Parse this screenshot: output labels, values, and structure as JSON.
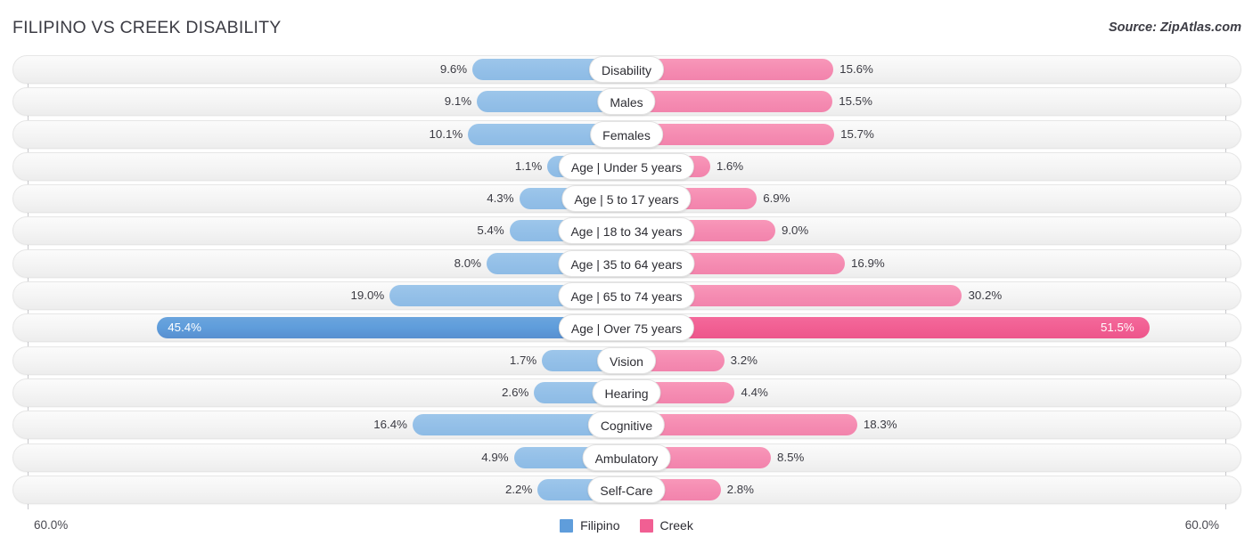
{
  "header": {
    "title": "FILIPINO VS CREEK DISABILITY",
    "source": "Source: ZipAtlas.com"
  },
  "axis": {
    "left_label": "60.0%",
    "right_label": "60.0%",
    "max": 60.0
  },
  "legend": [
    {
      "name": "legend-filipino",
      "label": "Filipino",
      "color": "#5f9ddb"
    },
    {
      "name": "legend-creek",
      "label": "Creek",
      "color": "#f15f93"
    }
  ],
  "colors": {
    "filipino": "#94c0e8",
    "creek": "#f58cb2",
    "filipino_highlight": "#5f9ddb",
    "creek_highlight": "#f15f93",
    "track": "#f4f4f4",
    "text": "#3a3a42"
  },
  "chart_data": {
    "type": "bar",
    "title": "FILIPINO VS CREEK DISABILITY",
    "subtitle": "Source: ZipAtlas.com",
    "orientation": "horizontal-diverging",
    "xlabel": "",
    "ylabel": "",
    "xlim": [
      60.0,
      60.0
    ],
    "grid": false,
    "legend_position": "bottom-center",
    "categories": [
      "Disability",
      "Males",
      "Females",
      "Age | Under 5 years",
      "Age | 5 to 17 years",
      "Age | 18 to 34 years",
      "Age | 35 to 64 years",
      "Age | 65 to 74 years",
      "Age | Over 75 years",
      "Vision",
      "Hearing",
      "Cognitive",
      "Ambulatory",
      "Self-Care"
    ],
    "series": [
      {
        "name": "Filipino",
        "color": "#94c0e8",
        "values": [
          9.6,
          9.1,
          10.1,
          1.1,
          4.3,
          5.4,
          8.0,
          19.0,
          45.4,
          1.7,
          2.6,
          16.4,
          4.9,
          2.2
        ],
        "labels": [
          "9.6%",
          "9.1%",
          "10.1%",
          "1.1%",
          "4.3%",
          "5.4%",
          "8.0%",
          "19.0%",
          "45.4%",
          "1.7%",
          "2.6%",
          "16.4%",
          "4.9%",
          "2.2%"
        ]
      },
      {
        "name": "Creek",
        "color": "#f58cb2",
        "values": [
          15.6,
          15.5,
          15.7,
          1.6,
          6.9,
          9.0,
          16.9,
          30.2,
          51.5,
          3.2,
          4.4,
          18.3,
          8.5,
          2.8
        ],
        "labels": [
          "15.6%",
          "15.5%",
          "15.7%",
          "1.6%",
          "6.9%",
          "9.0%",
          "16.9%",
          "30.2%",
          "51.5%",
          "3.2%",
          "4.4%",
          "18.3%",
          "8.5%",
          "2.8%"
        ]
      }
    ]
  },
  "rows": [
    {
      "label": "Disability",
      "left_value": "9.6%",
      "right_value": "15.6%",
      "left_num": 9.6,
      "right_num": 15.6,
      "highlight": false
    },
    {
      "label": "Males",
      "left_value": "9.1%",
      "right_value": "15.5%",
      "left_num": 9.1,
      "right_num": 15.5,
      "highlight": false
    },
    {
      "label": "Females",
      "left_value": "10.1%",
      "right_value": "15.7%",
      "left_num": 10.1,
      "right_num": 15.7,
      "highlight": false
    },
    {
      "label": "Age | Under 5 years",
      "left_value": "1.1%",
      "right_value": "1.6%",
      "left_num": 1.1,
      "right_num": 1.6,
      "highlight": false
    },
    {
      "label": "Age | 5 to 17 years",
      "left_value": "4.3%",
      "right_value": "6.9%",
      "left_num": 4.3,
      "right_num": 6.9,
      "highlight": false
    },
    {
      "label": "Age | 18 to 34 years",
      "left_value": "5.4%",
      "right_value": "9.0%",
      "left_num": 5.4,
      "right_num": 9.0,
      "highlight": false
    },
    {
      "label": "Age | 35 to 64 years",
      "left_value": "8.0%",
      "right_value": "16.9%",
      "left_num": 8.0,
      "right_num": 16.9,
      "highlight": false
    },
    {
      "label": "Age | 65 to 74 years",
      "left_value": "19.0%",
      "right_value": "30.2%",
      "left_num": 19.0,
      "right_num": 30.2,
      "highlight": false
    },
    {
      "label": "Age | Over 75 years",
      "left_value": "45.4%",
      "right_value": "51.5%",
      "left_num": 45.4,
      "right_num": 51.5,
      "highlight": true
    },
    {
      "label": "Vision",
      "left_value": "1.7%",
      "right_value": "3.2%",
      "left_num": 1.7,
      "right_num": 3.2,
      "highlight": false
    },
    {
      "label": "Hearing",
      "left_value": "2.6%",
      "right_value": "4.4%",
      "left_num": 2.6,
      "right_num": 4.4,
      "highlight": false
    },
    {
      "label": "Cognitive",
      "left_value": "16.4%",
      "right_value": "18.3%",
      "left_num": 16.4,
      "right_num": 18.3,
      "highlight": false
    },
    {
      "label": "Ambulatory",
      "left_value": "4.9%",
      "right_value": "8.5%",
      "left_num": 4.9,
      "right_num": 8.5,
      "highlight": false
    },
    {
      "label": "Self-Care",
      "left_value": "2.2%",
      "right_value": "2.8%",
      "left_num": 2.2,
      "right_num": 2.8,
      "highlight": false
    }
  ]
}
